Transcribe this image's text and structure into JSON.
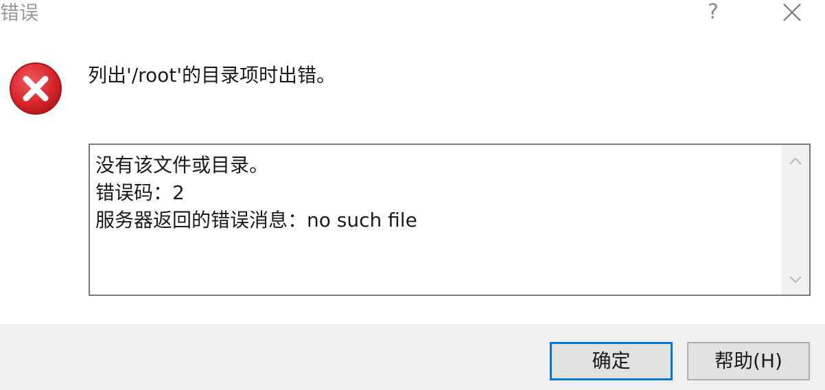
{
  "window": {
    "title": "错误",
    "help_glyph": "?",
    "close_icon": "close-icon"
  },
  "message": {
    "icon": "error-icon",
    "text": "列出'/root'的目录项时出错。"
  },
  "details": {
    "lines": [
      "没有该文件或目录。",
      "错误码：2",
      "服务器返回的错误消息：no such file"
    ]
  },
  "buttons": {
    "ok_label": "确定",
    "help_label": "帮助(H)"
  },
  "colors": {
    "error_red": "#d9262b",
    "accent_blue": "#0078d7",
    "footer_bg": "#f0f0f0"
  }
}
